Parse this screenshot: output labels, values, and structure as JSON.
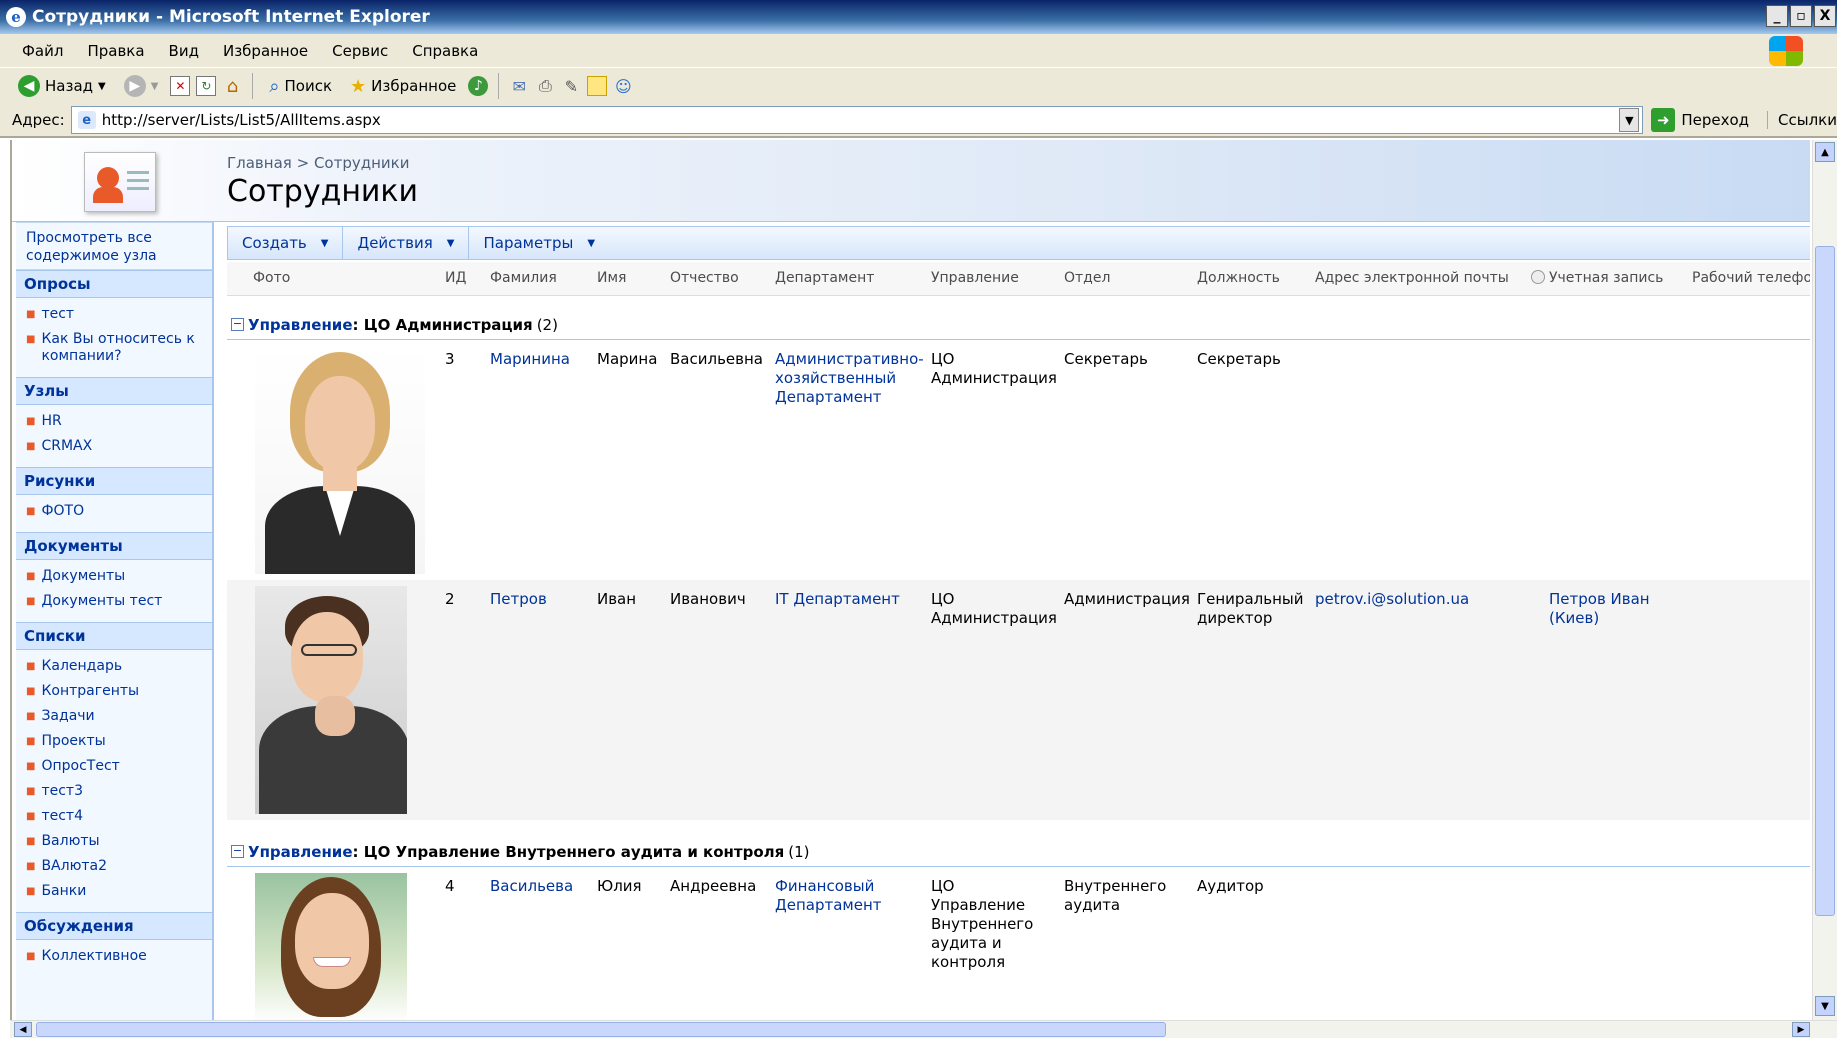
{
  "window": {
    "title": "Сотрудники - Microsoft Internet Explorer",
    "controls": [
      "_",
      "▫",
      "X"
    ]
  },
  "menu": [
    "Файл",
    "Правка",
    "Вид",
    "Избранное",
    "Сервис",
    "Справка"
  ],
  "toolbar": {
    "back_label": "Назад",
    "search_label": "Поиск",
    "favorites_label": "Избранное"
  },
  "address": {
    "label": "Адрес:",
    "url": "http://server/Lists/List5/AllItems.aspx",
    "go_label": "Переход",
    "links_label": "Ссылки"
  },
  "site": {
    "breadcrumb_home": "Главная",
    "breadcrumb_sep": ">",
    "breadcrumb_current": "Сотрудники",
    "page_title": "Сотрудники"
  },
  "leftnav": {
    "view_all": "Просмотреть все содержимое узла",
    "sections": [
      {
        "title": "Опросы",
        "items": [
          "тест",
          "Как Вы относитесь к компании?"
        ]
      },
      {
        "title": "Узлы",
        "items": [
          "HR",
          "CRMAX"
        ]
      },
      {
        "title": "Рисунки",
        "items": [
          "ФОТО"
        ]
      },
      {
        "title": "Документы",
        "items": [
          "Документы",
          "Документы тест"
        ]
      },
      {
        "title": "Списки",
        "items": [
          "Календарь",
          "Контрагенты",
          "Задачи",
          "Проекты",
          "ОпросТест",
          "тест3",
          "тест4",
          "Валюты",
          "ВАлюта2",
          "Банки"
        ]
      },
      {
        "title": "Обсуждения",
        "items": [
          "Коллективное"
        ]
      }
    ]
  },
  "listbar": {
    "create": "Создать",
    "actions": "Действия",
    "settings": "Параметры"
  },
  "columns": {
    "photo": "Фото",
    "id": "ИД",
    "last": "Фамилия",
    "first": "Имя",
    "middle": "Отчество",
    "dept": "Департамент",
    "mgmt": "Управление",
    "unit": "Отдел",
    "position": "Должность",
    "email": "Адрес электронной почты",
    "account": "Учетная запись",
    "phone": "Рабочий телефон"
  },
  "groups": [
    {
      "label": "Управление",
      "value": ": ЦО Администрация",
      "count": "(2)",
      "rows": [
        {
          "id": "3",
          "last": "Маринина",
          "first": "Марина",
          "middle": "Васильевна",
          "dept": "Административно-хозяйственный Департамент",
          "mgmt": "ЦО Администрация",
          "unit": "Секретарь",
          "position": "Секретарь",
          "email": "",
          "account": ""
        },
        {
          "id": "2",
          "last": "Петров",
          "first": "Иван",
          "middle": "Иванович",
          "dept": "IT Департамент",
          "mgmt": "ЦО Администрация",
          "unit": "Администрация",
          "position": "Гениральный директор",
          "email": "petrov.i@solution.ua",
          "account": "Петров Иван (Киев)"
        }
      ]
    },
    {
      "label": "Управление",
      "value": ": ЦО Управление Внутреннего аудита и контроля",
      "count": "(1)",
      "rows": [
        {
          "id": "4",
          "last": "Васильева",
          "first": "Юлия",
          "middle": "Андреевна",
          "dept": "Финансовый Департамент",
          "mgmt": "ЦО Управление Внутреннего аудита и контроля",
          "unit": "Внутреннего аудита",
          "position": "Аудитор",
          "email": "",
          "account": ""
        }
      ]
    }
  ],
  "colors": {
    "link": "#003399",
    "accent": "#e85a2a",
    "nav_bg": "#f2f8ff",
    "title_bar": "#0a246a"
  },
  "icons": [
    "ie-icon",
    "back-icon",
    "forward-icon",
    "stop-icon",
    "refresh-icon",
    "home-icon",
    "search-icon",
    "favorites-icon",
    "media-icon",
    "mail-icon",
    "print-icon",
    "edit-icon",
    "discuss-icon",
    "messenger-icon",
    "go-icon",
    "windows-logo-icon",
    "site-logo-icon",
    "presence-icon"
  ]
}
